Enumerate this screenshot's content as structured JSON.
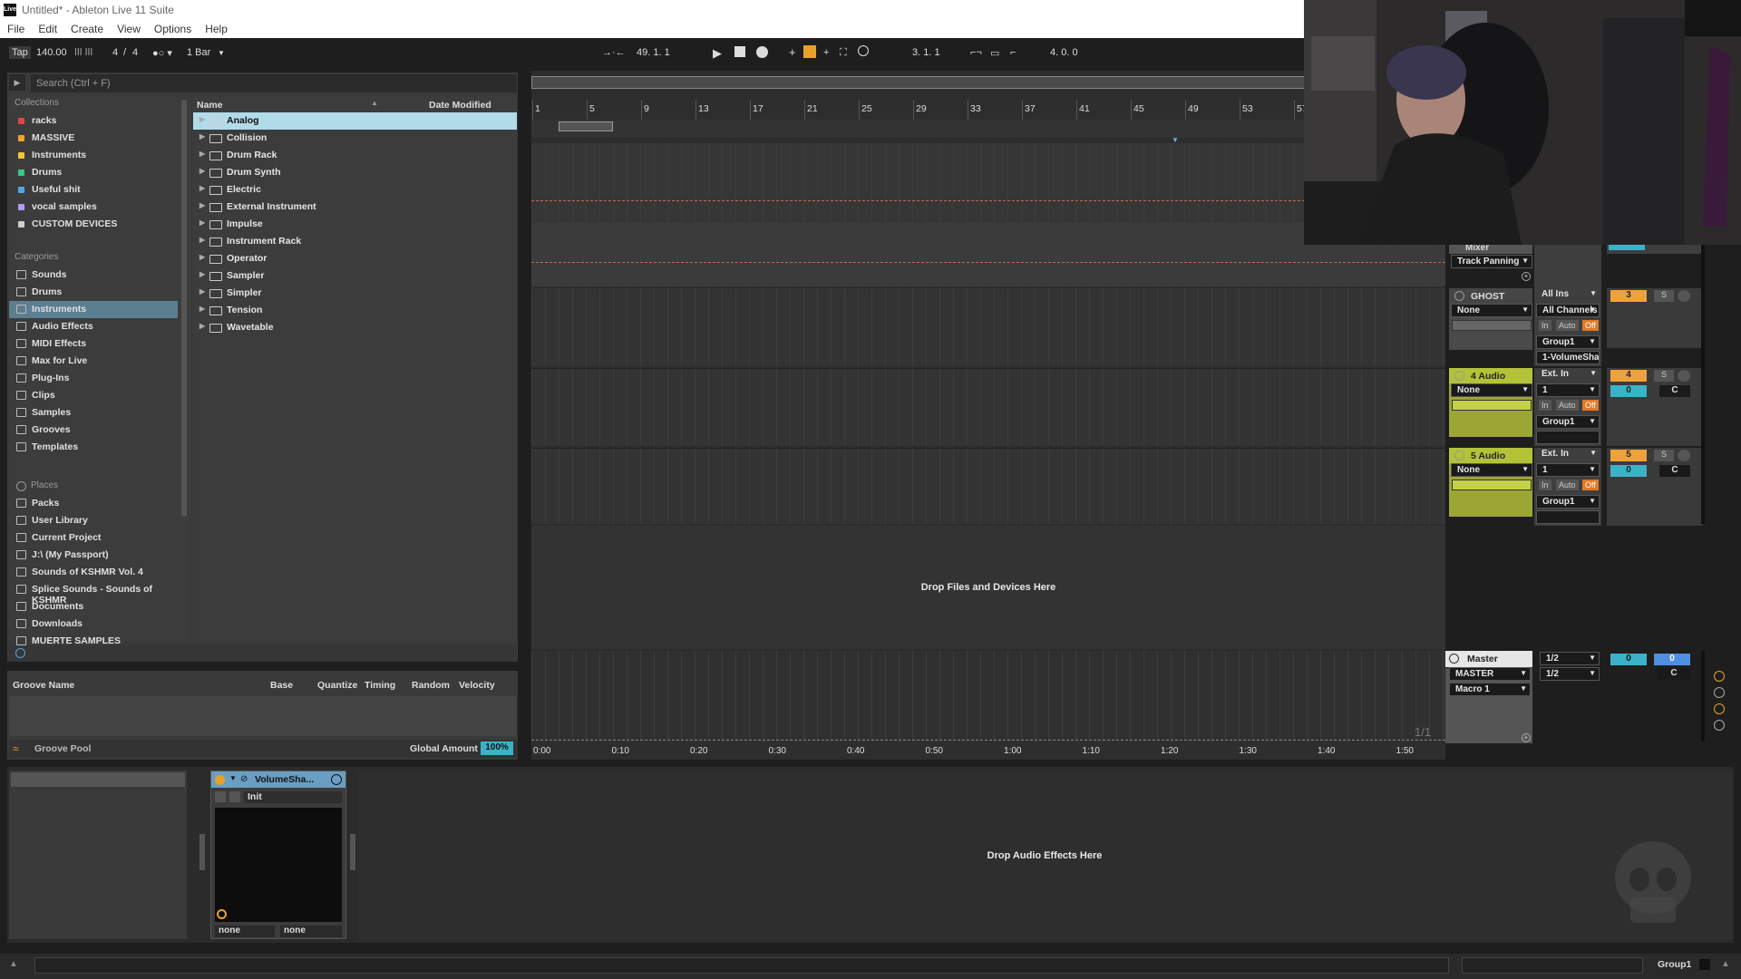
{
  "window": {
    "title": "Untitled* - Ableton Live 11 Suite",
    "logo_text": "Live"
  },
  "menu": [
    "File",
    "Edit",
    "Create",
    "View",
    "Options",
    "Help"
  ],
  "control_bar": {
    "tap": "Tap",
    "tempo": "140.00",
    "signature_num": "4",
    "signature_sep": "/",
    "signature_den": "4",
    "quantize": "1 Bar",
    "arrangement_position": "49.   1.   1",
    "loop_start": "3.   1.   1",
    "loop_length": "4.   0.   0"
  },
  "browser": {
    "search_placeholder": "Search (Ctrl + F)",
    "collections_header": "Collections",
    "collections": [
      {
        "label": "racks",
        "color": "#e3434c"
      },
      {
        "label": "MASSIVE",
        "color": "#f0a12b"
      },
      {
        "label": "Instruments",
        "color": "#f5c43a"
      },
      {
        "label": "Drums",
        "color": "#3fc489"
      },
      {
        "label": "Useful shit",
        "color": "#4fa6e8"
      },
      {
        "label": "vocal samples",
        "color": "#b19cf1"
      },
      {
        "label": "CUSTOM DEVICES",
        "color": "#cfcfcf"
      }
    ],
    "categories_header": "Categories",
    "categories": [
      {
        "label": "Sounds",
        "icon": "sounds-icon"
      },
      {
        "label": "Drums",
        "icon": "drums-icon"
      },
      {
        "label": "Instruments",
        "icon": "instruments-icon",
        "selected": true
      },
      {
        "label": "Audio Effects",
        "icon": "audio-effects-icon"
      },
      {
        "label": "MIDI Effects",
        "icon": "midi-effects-icon"
      },
      {
        "label": "Max for Live",
        "icon": "max-for-live-icon"
      },
      {
        "label": "Plug-Ins",
        "icon": "plug-ins-icon"
      },
      {
        "label": "Clips",
        "icon": "clips-icon"
      },
      {
        "label": "Samples",
        "icon": "samples-icon"
      },
      {
        "label": "Grooves",
        "icon": "grooves-icon"
      },
      {
        "label": "Templates",
        "icon": "templates-icon"
      }
    ],
    "places_header": "Places",
    "places": [
      {
        "label": "Packs",
        "icon": "packs-icon"
      },
      {
        "label": "User Library",
        "icon": "user-library-icon"
      },
      {
        "label": "Current Project",
        "icon": "current-project-icon"
      },
      {
        "label": "J:\\ (My Passport)",
        "icon": "folder-icon"
      },
      {
        "label": "Sounds of KSHMR Vol. 4",
        "icon": "folder-icon"
      },
      {
        "label": "Splice Sounds - Sounds of KSHMR",
        "icon": "folder-icon"
      },
      {
        "label": "Documents",
        "icon": "folder-icon"
      },
      {
        "label": "Downloads",
        "icon": "folder-icon"
      },
      {
        "label": "MUERTE SAMPLES",
        "icon": "folder-icon"
      }
    ],
    "columns": {
      "name": "Name",
      "date": "Date Modified"
    },
    "items": [
      "Analog",
      "Collision",
      "Drum Rack",
      "Drum Synth",
      "Electric",
      "External Instrument",
      "Impulse",
      "Instrument Rack",
      "Operator",
      "Sampler",
      "Simpler",
      "Tension",
      "Wavetable"
    ],
    "selected_item": "Analog"
  },
  "groove_pool": {
    "columns": [
      "Groove Name",
      "Base",
      "Quantize",
      "Timing",
      "Random",
      "Velocity"
    ],
    "title": "Groove Pool",
    "global_amount_label": "Global Amount",
    "global_amount": "100%"
  },
  "arrangement": {
    "bar_numbers": [
      "1",
      "5",
      "9",
      "13",
      "17",
      "21",
      "25",
      "29",
      "33",
      "37",
      "41",
      "45",
      "49",
      "53",
      "57"
    ],
    "time_labels": [
      "0:00",
      "0:10",
      "0:20",
      "0:30",
      "0:40",
      "0:50",
      "1:00",
      "1:10",
      "1:20",
      "1:30",
      "1:40",
      "1:50"
    ],
    "drop_files": "Drop Files and Devices Here",
    "page_indicator": "1/1"
  },
  "mixer": {
    "top_partial": {
      "label": "Mixer",
      "dropdown": "Track Panning"
    },
    "tracks": [
      {
        "name": "GHOST",
        "input_type": "None",
        "input": "All Ins",
        "channel": "All Channels",
        "in_label": "In",
        "auto_label": "Auto",
        "off_label": "Off",
        "output": "Group1",
        "output2": "1-VolumeShaper",
        "number": "3",
        "number_color": "#f0a23a"
      },
      {
        "name": "4 Audio",
        "input_type": "None",
        "input": "Ext. In",
        "channel": "1",
        "in_label": "In",
        "auto_label": "Auto",
        "off_label": "Off",
        "output": "Group1",
        "number": "4",
        "number_color": "#f0a23a",
        "volume": "0",
        "pan": "C"
      },
      {
        "name": "5 Audio",
        "input_type": "None",
        "input": "Ext. In",
        "channel": "1",
        "in_label": "In",
        "auto_label": "Auto",
        "off_label": "Off",
        "output": "Group1",
        "number": "5",
        "number_color": "#f0a23a",
        "volume": "0",
        "pan": "C"
      }
    ],
    "solo_label": "S",
    "master": {
      "name": "Master",
      "dropdown1": "MASTER",
      "dropdown2": "Macro 1",
      "cue1": "1/2",
      "cue2": "1/2",
      "volume": "0",
      "volume2": "0",
      "pan": "C"
    }
  },
  "device_chain": {
    "device_name": "VolumeSha...",
    "preset": "Init",
    "param1": "none",
    "param2": "none",
    "drop_effects": "Drop Audio Effects Here"
  },
  "status_bar": {
    "track": "Group1"
  }
}
